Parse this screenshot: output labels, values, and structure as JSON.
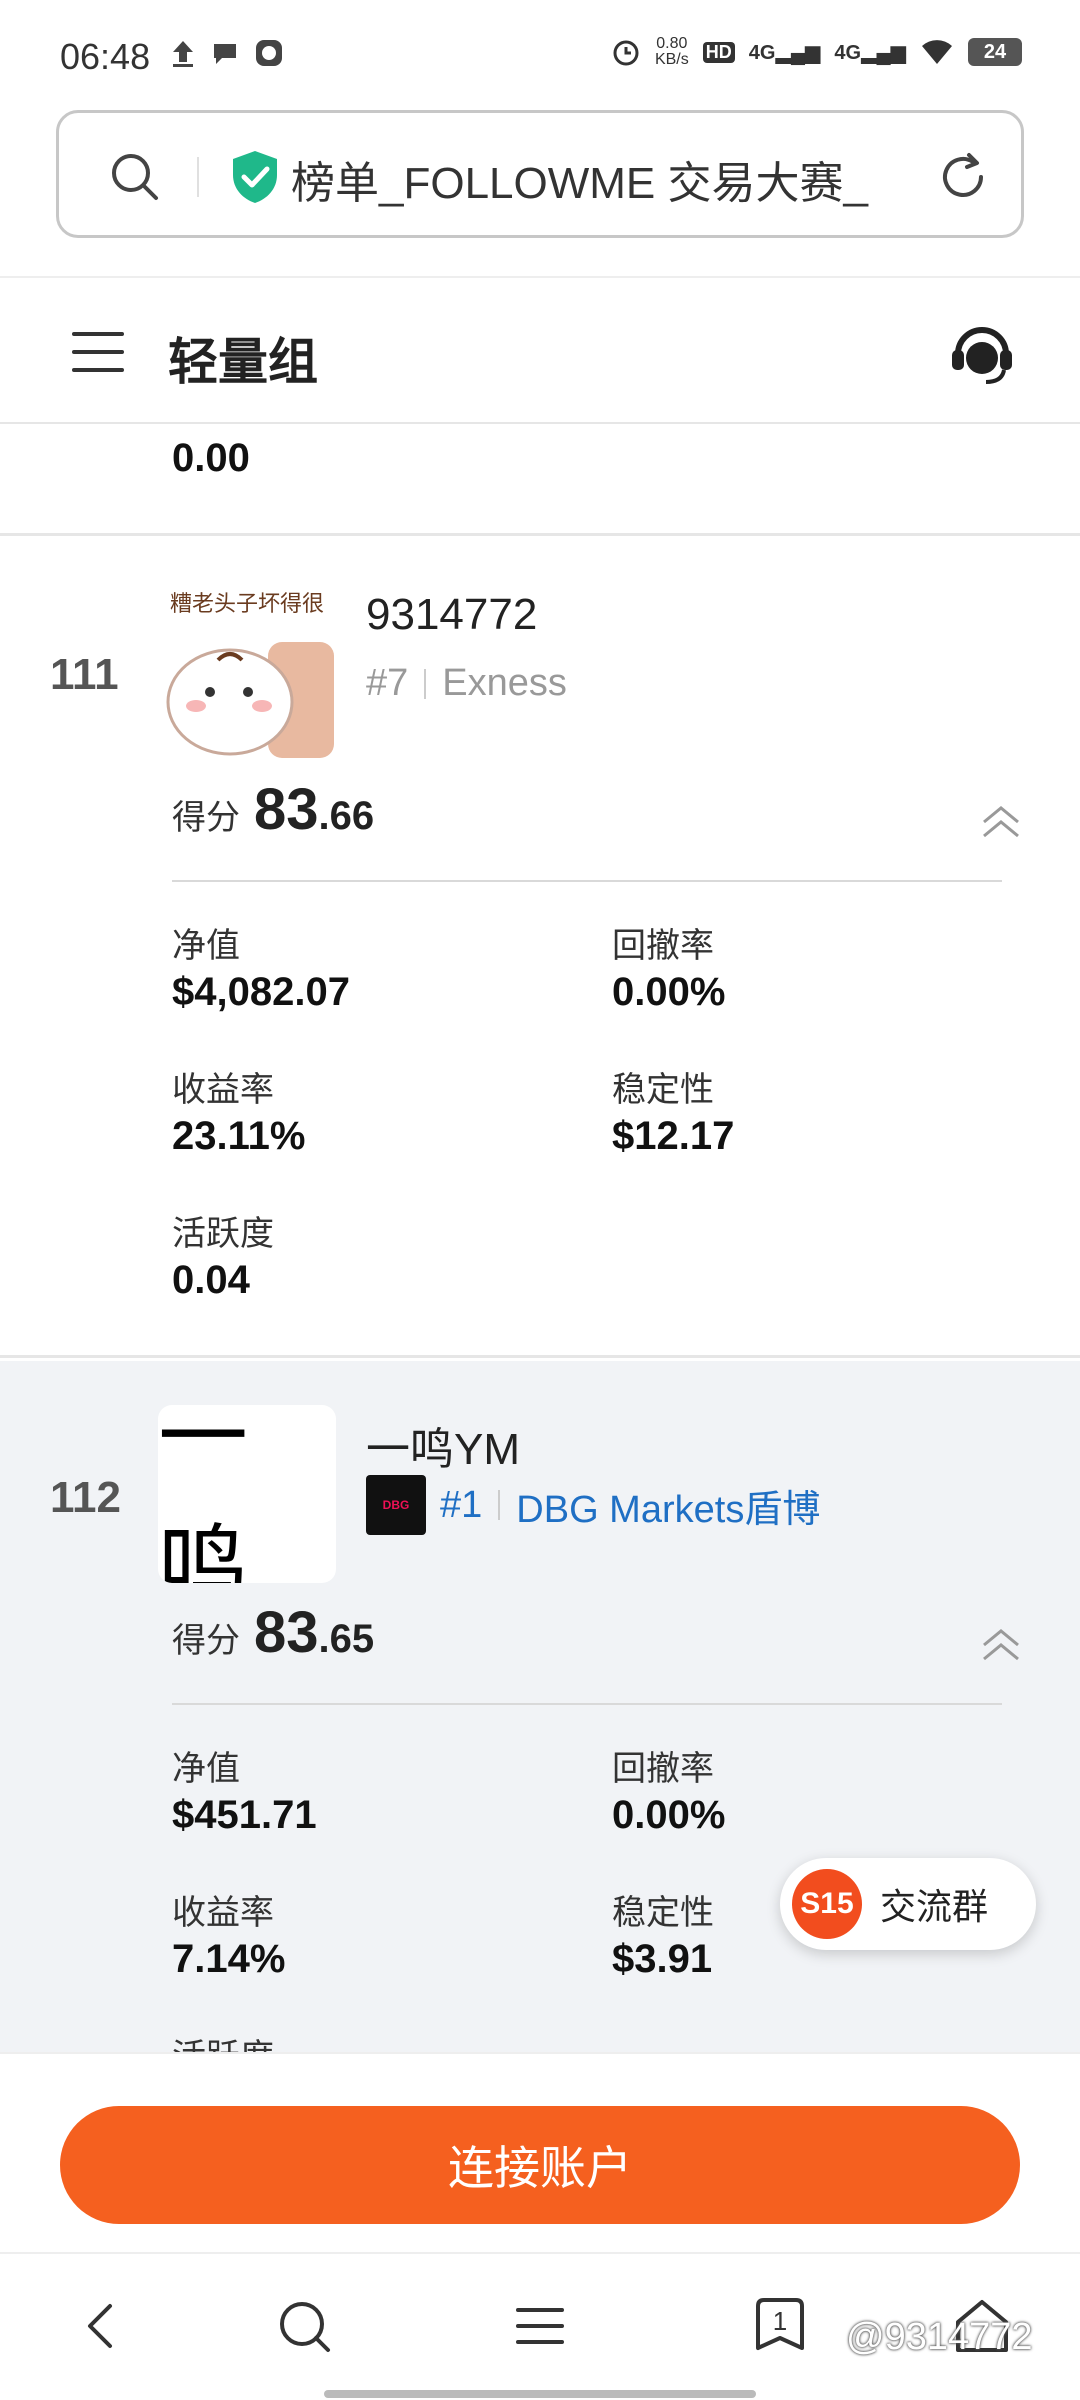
{
  "status_bar": {
    "time": "06:48",
    "net_speed_value": "0.80",
    "net_speed_unit": "KB/s",
    "hd_badge": "HD",
    "signal_1": "4G",
    "signal_2": "4G",
    "battery": "24"
  },
  "url_bar": {
    "title": "榜单_FOLLOWME 交易大赛_"
  },
  "header": {
    "title": "轻量组"
  },
  "prev_card": {
    "value": "0.00"
  },
  "cards": [
    {
      "rank": "111",
      "avatar_caption": "糟老头子坏得很",
      "username": "9314772",
      "account_rank": "#7",
      "broker": "Exness",
      "score_label": "得分",
      "score_int": "83",
      "score_dec": ".66",
      "stats": {
        "equity_label": "净值",
        "equity": "$4,082.07",
        "drawdown_label": "回撤率",
        "drawdown": "0.00%",
        "return_label": "收益率",
        "return": "23.11%",
        "stability_label": "稳定性",
        "stability": "$12.17",
        "activity_label": "活跃度",
        "activity": "0.04"
      }
    },
    {
      "rank": "112",
      "avatar_text": "一鸣",
      "username": "一鸣YM",
      "broker_logo_text": "DBG",
      "account_rank": "#1",
      "broker": "DBG Markets盾博",
      "score_label": "得分",
      "score_int": "83",
      "score_dec": ".65",
      "stats": {
        "equity_label": "净值",
        "equity": "$451.71",
        "drawdown_label": "回撤率",
        "drawdown": "0.00%",
        "return_label": "收益率",
        "return": "7.14%",
        "stability_label": "稳定性",
        "stability": "$3.91",
        "activity_label": "活跃度"
      }
    }
  ],
  "chat_fab": {
    "badge": "S15",
    "label": "交流群"
  },
  "bottom": {
    "connect_label": "连接账户"
  },
  "nav": {
    "tabs_count": "1",
    "watermark": "@9314772"
  },
  "colors": {
    "accent": "#f5601f",
    "link_blue": "#1f6fc4",
    "shield_green": "#1fb88a"
  }
}
